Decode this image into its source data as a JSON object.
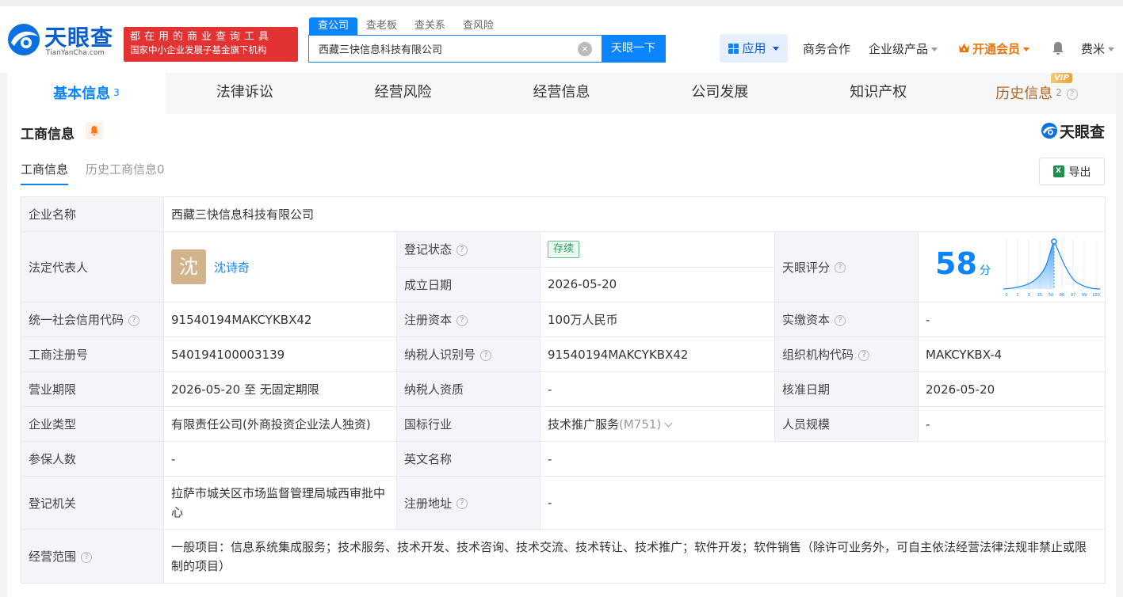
{
  "header": {
    "logo_cn": "天眼查",
    "logo_en": "TianYanCha.com",
    "slogan_line1": "都在用的商业查询工具",
    "slogan_line2": "国家中小企业发展子基金旗下机构",
    "search_tabs": [
      "查公司",
      "查老板",
      "查关系",
      "查风险"
    ],
    "search_value": "西藏三快信息科技有限公司",
    "search_clear": "×",
    "search_button": "天眼一下",
    "app_label": "应用",
    "business_coop": "商务合作",
    "enterprise_products": "企业级产品",
    "vip": "开通会员",
    "user": "费米",
    "accent": "#0a84ff"
  },
  "tabs": [
    {
      "label": "基本信息",
      "count": "3"
    },
    {
      "label": "法律诉讼"
    },
    {
      "label": "经营风险"
    },
    {
      "label": "经营信息"
    },
    {
      "label": "公司发展"
    },
    {
      "label": "知识产权"
    },
    {
      "label": "历史信息",
      "count": "2",
      "badge": "VIP"
    }
  ],
  "section": {
    "title": "工商信息",
    "brand": "天眼查",
    "subtabs": [
      "工商信息",
      "历史工商信息0"
    ],
    "export": "导出",
    "xls_icon": "X"
  },
  "info": {
    "company_name_label": "企业名称",
    "company_name": "西藏三快信息科技有限公司",
    "legal_rep_label": "法定代表人",
    "legal_rep_avatar": "沈",
    "legal_rep": "沈诗奇",
    "reg_status_label": "登记状态",
    "reg_status": "存续",
    "founded_label": "成立日期",
    "founded": "2026-05-20",
    "score_label": "天眼评分",
    "score": "58",
    "score_unit": "分",
    "score_axis": [
      "0",
      "1",
      "3",
      "15",
      "50",
      "86",
      "97",
      "99",
      "100"
    ],
    "credit_code_label": "统一社会信用代码",
    "credit_code": "91540194MAKCYKBX42",
    "reg_capital_label": "注册资本",
    "reg_capital": "100万人民币",
    "paid_capital_label": "实缴资本",
    "paid_capital": "-",
    "reg_no_label": "工商注册号",
    "reg_no": "540194100003139",
    "taxpayer_id_label": "纳税人识别号",
    "taxpayer_id": "91540194MAKCYKBX42",
    "org_code_label": "组织机构代码",
    "org_code": "MAKCYKBX-4",
    "term_label": "营业期限",
    "term": "2026-05-20 至 无固定期限",
    "taxpayer_qual_label": "纳税人资质",
    "taxpayer_qual": "-",
    "approve_date_label": "核准日期",
    "approve_date": "2026-05-20",
    "type_label": "企业类型",
    "type": "有限责任公司(外商投资企业法人独资)",
    "industry_label": "国标行业",
    "industry": "技术推广服务",
    "industry_code": "(M751)",
    "staff_size_label": "人员规模",
    "staff_size": "-",
    "insured_label": "参保人数",
    "insured": "-",
    "english_name_label": "英文名称",
    "english_name": "-",
    "authority_label": "登记机关",
    "authority": "拉萨市城关区市场监督管理局城西审批中心",
    "reg_address_label": "注册地址",
    "reg_address": "-",
    "scope_label": "经营范围",
    "scope": "一般项目：信息系统集成服务；技术服务、技术开发、技术咨询、技术交流、技术转让、技术推广；软件开发；软件销售（除许可业务外，可自主依法经营法律法规非禁止或限制的项目）"
  }
}
